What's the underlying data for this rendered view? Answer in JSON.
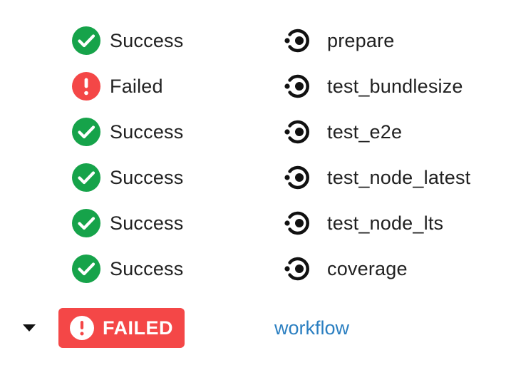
{
  "colors": {
    "success": "#16a34a",
    "failed": "#f44747",
    "link": "#2b7fc1",
    "text": "#212121"
  },
  "jobs": [
    {
      "status": "Success",
      "status_icon": "check-circle-icon",
      "name": "prepare",
      "job_icon": "job-step-icon"
    },
    {
      "status": "Failed",
      "status_icon": "alert-circle-icon",
      "name": "test_bundlesize",
      "job_icon": "job-step-icon"
    },
    {
      "status": "Success",
      "status_icon": "check-circle-icon",
      "name": "test_e2e",
      "job_icon": "job-step-icon"
    },
    {
      "status": "Success",
      "status_icon": "check-circle-icon",
      "name": "test_node_latest",
      "job_icon": "job-step-icon"
    },
    {
      "status": "Success",
      "status_icon": "check-circle-icon",
      "name": "test_node_lts",
      "job_icon": "job-step-icon"
    },
    {
      "status": "Success",
      "status_icon": "check-circle-icon",
      "name": "coverage",
      "job_icon": "job-step-icon"
    }
  ],
  "workflow": {
    "toggle_icon": "caret-down-icon",
    "badge_label": "FAILED",
    "badge_icon": "alert-circle-icon",
    "name": "workflow"
  }
}
